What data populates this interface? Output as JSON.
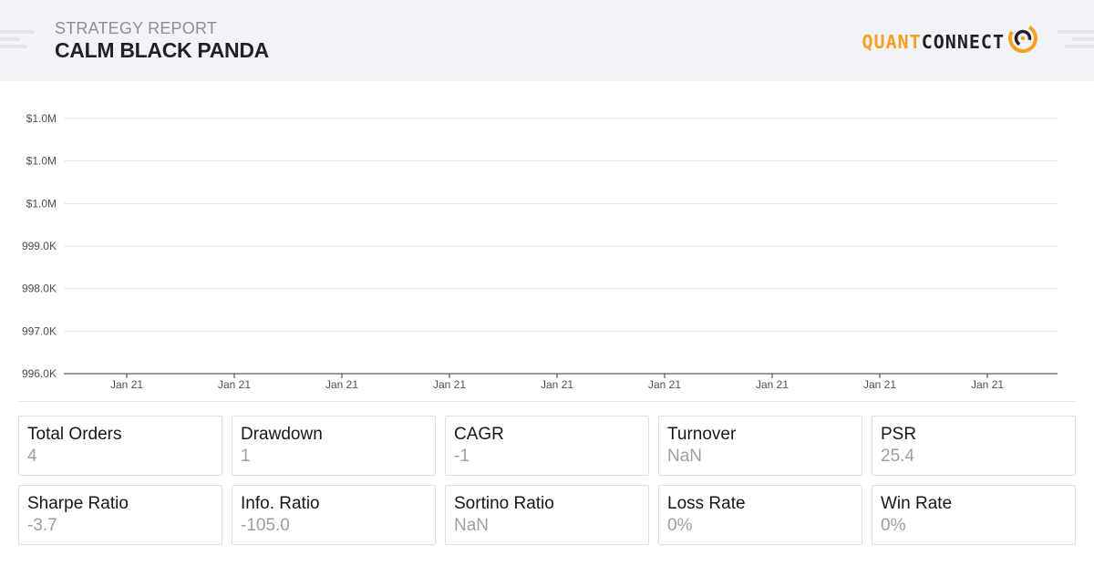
{
  "header": {
    "subtitle": "STRATEGY REPORT",
    "title": "CALM BLACK PANDA",
    "logo": {
      "text_part1": "QUANT",
      "text_part2": "CONNECT",
      "icon": "quantconnect-swirl-icon",
      "accent_color": "#f5a11f",
      "dark_color": "#1f2127"
    }
  },
  "chart_data": {
    "type": "line",
    "title": "",
    "xlabel": "",
    "ylabel": "",
    "y_ticks": [
      "$1.0M",
      "$1.0M",
      "$1.0M",
      "999.0K",
      "998.0K",
      "997.0K",
      "996.0K"
    ],
    "x_ticks": [
      "Jan 21",
      "Jan 21",
      "Jan 21",
      "Jan 21",
      "Jan 21",
      "Jan 21",
      "Jan 21",
      "Jan 21",
      "Jan 21"
    ],
    "ylim": [
      996000,
      1002000
    ],
    "series": [],
    "grid": true
  },
  "stats": [
    {
      "label": "Total Orders",
      "value": "4"
    },
    {
      "label": "Drawdown",
      "value": "1"
    },
    {
      "label": "CAGR",
      "value": "-1"
    },
    {
      "label": "Turnover",
      "value": "NaN"
    },
    {
      "label": "PSR",
      "value": "25.4"
    },
    {
      "label": "Sharpe Ratio",
      "value": "-3.7"
    },
    {
      "label": "Info. Ratio",
      "value": "-105.0"
    },
    {
      "label": "Sortino Ratio",
      "value": "NaN"
    },
    {
      "label": "Loss Rate",
      "value": "0%"
    },
    {
      "label": "Win Rate",
      "value": "0%"
    }
  ]
}
